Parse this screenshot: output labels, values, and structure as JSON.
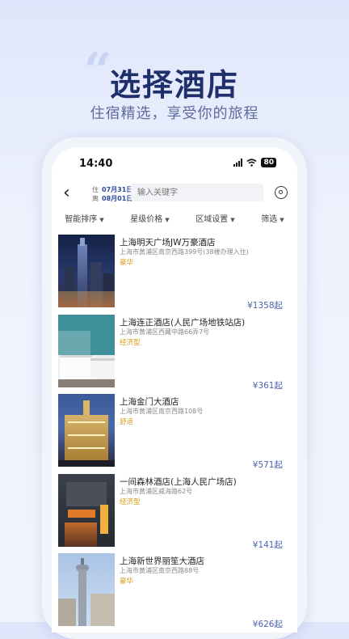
{
  "promo": {
    "quote": "“",
    "headline": "选择酒店",
    "subline": "住宿精选，享受你的旅程"
  },
  "status_bar": {
    "time": "14:40",
    "battery": "80"
  },
  "search": {
    "checkin_label": "住",
    "checkin_date": "07月31日",
    "checkout_label": "离",
    "checkout_date": "08月01日",
    "placeholder": "输入关键字"
  },
  "filters": [
    {
      "label": "智能排序"
    },
    {
      "label": "星级价格"
    },
    {
      "label": "区域设置"
    },
    {
      "label": "筛选"
    }
  ],
  "hotels": [
    {
      "name": "上海明天广场JW万豪酒店",
      "address": "上海市黄浦区南京西路399号(38楼办理入住)",
      "tag": "豪华",
      "price": "¥1358起"
    },
    {
      "name": "上海连正酒店(人民广场地铁站店)",
      "address": "上海市黄浦区西藏中路66弄7号",
      "tag": "经济型",
      "price": "¥361起"
    },
    {
      "name": "上海金门大酒店",
      "address": "上海市黄浦区南京西路108号",
      "tag": "舒适",
      "price": "¥571起"
    },
    {
      "name": "一间森林酒店(上海人民广场店)",
      "address": "上海市黄浦区威海路62号",
      "tag": "经济型",
      "price": "¥141起"
    },
    {
      "name": "上海新世界丽笙大酒店",
      "address": "上海市黄浦区南京西路88号",
      "tag": "豪华",
      "price": "¥626起"
    }
  ]
}
